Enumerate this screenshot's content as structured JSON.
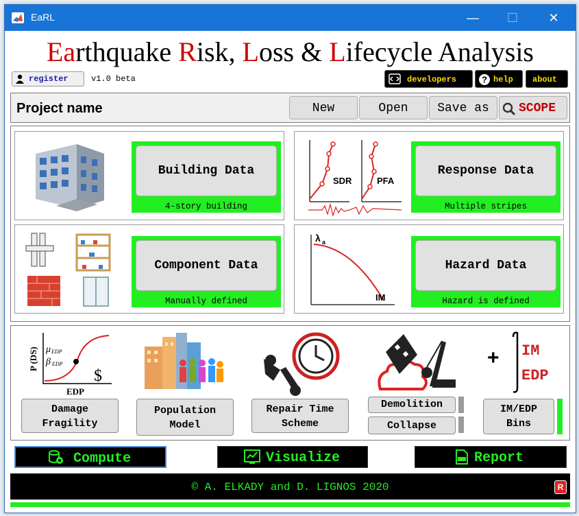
{
  "window": {
    "title": "EaRL"
  },
  "banner": {
    "p1": "Ea",
    "p2": "rthquake ",
    "p3": "R",
    "p4": "isk, ",
    "p5": "L",
    "p6": "oss & ",
    "p7": "L",
    "p8": "ifecycle Analysis"
  },
  "account": {
    "register": "register",
    "version": "v1.0 beta"
  },
  "topbtns": {
    "developers": "developers",
    "help": "help",
    "about": "about"
  },
  "project": {
    "name": "Project name",
    "new": "New",
    "open": "Open",
    "saveas": "Save as",
    "scope": "SCOPE"
  },
  "cards": {
    "building": {
      "label": "Building Data",
      "caption": "4-story building"
    },
    "response": {
      "label": "Response Data",
      "caption": "Multiple stripes",
      "sdr": "SDR",
      "pfa": "PFA"
    },
    "component": {
      "label": "Component Data",
      "caption": "Manually defined"
    },
    "hazard": {
      "label": "Hazard Data",
      "caption": "Hazard is defined",
      "lambda": "λ",
      "sub": "a",
      "im": "IM"
    }
  },
  "tools": {
    "fragility": [
      "Damage",
      "Fragility"
    ],
    "population": [
      "Population",
      "Model"
    ],
    "repair": [
      "Repair Time",
      "Scheme"
    ],
    "demolition": "Demolition",
    "collapse": "Collapse",
    "bins": [
      "IM/EDP",
      "Bins"
    ],
    "frag_axes": {
      "y": "P (DS)",
      "x": "EDP",
      "mu": "μ",
      "mu_sub": "EDP",
      "beta": "β",
      "beta_sub": "EDP",
      "dollar": "$"
    },
    "imedp": {
      "im": "IM",
      "edp": "EDP",
      "plus": "+"
    }
  },
  "actions": {
    "compute": "Compute",
    "visualize": "Visualize",
    "report": "Report"
  },
  "footer": {
    "text": "© A. ELKADY and D. LIGNOS 2020",
    "badge": "R"
  },
  "colors": {
    "accent_red": "#d00000",
    "accent_green": "#22ee22",
    "titlebar": "#1874d6"
  }
}
